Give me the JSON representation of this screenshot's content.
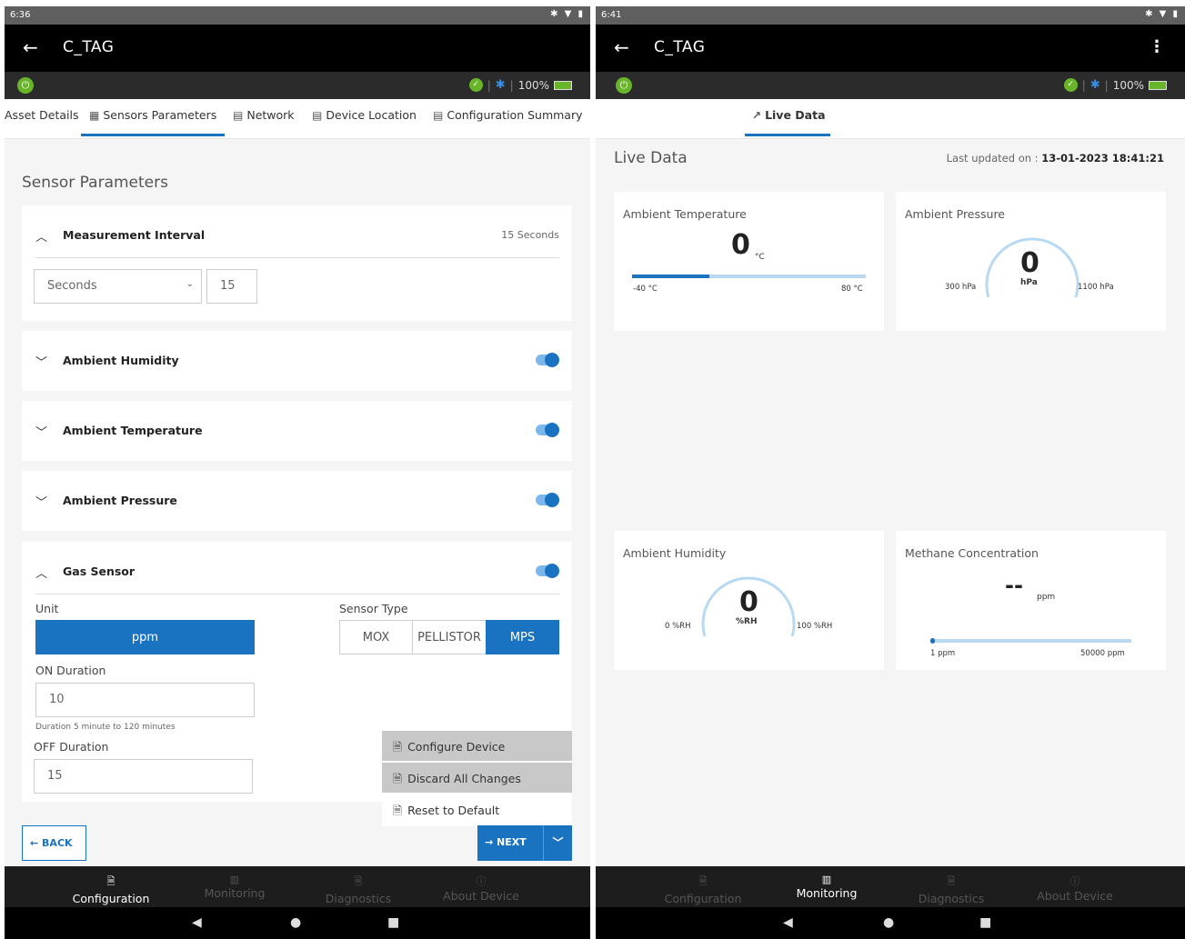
{
  "left": {
    "status_time": "6:36",
    "app_title": "C_TAG",
    "battery": "100%",
    "tabs": [
      "Asset Details",
      "Sensors Parameters",
      "Network",
      "Device Location",
      "Configuration Summary"
    ],
    "active_tab": "Sensors Parameters",
    "page_title": "Sensor Parameters",
    "measurement": {
      "label": "Measurement Interval",
      "value": "15 Seconds",
      "unit_select": "Seconds",
      "interval": "15"
    },
    "sections": [
      "Ambient Humidity",
      "Ambient Temperature",
      "Ambient Pressure"
    ],
    "toggles_on": true,
    "gas": {
      "label": "Gas Sensor",
      "unit_label": "Unit",
      "unit_value": "ppm",
      "sensor_type_label": "Sensor Type",
      "sensor_types": [
        "MOX",
        "PELLISTOR",
        "MPS"
      ],
      "selected_type": "MPS",
      "on_label": "ON Duration",
      "on_value": "10",
      "on_hint": "Duration 5 minute to 120 minutes",
      "off_label": "OFF Duration",
      "off_value": "15"
    },
    "menu": [
      "Configure Device",
      "Discard All Changes",
      "Reset to Default"
    ],
    "back_label": "BACK",
    "next_label": "NEXT",
    "bottom_nav": [
      "Configuration",
      "Monitoring",
      "Diagnostics",
      "About Device"
    ],
    "active_nav": "Configuration"
  },
  "right": {
    "status_time": "6:41",
    "app_title": "C_TAG",
    "battery": "100%",
    "tab": "Live Data",
    "page_title": "Live Data",
    "updated_label": "Last updated on : ",
    "updated_value": "13-01-2023 18:41:21",
    "temperature": {
      "title": "Ambient Temperature",
      "value": "0",
      "unit": "°C",
      "min": "-40 °C",
      "max": "80 °C",
      "fill_fraction": 0.33
    },
    "pressure": {
      "title": "Ambient Pressure",
      "value": "0",
      "unit": "hPa",
      "min": "300 hPa",
      "max": "1100 hPa"
    },
    "humidity": {
      "title": "Ambient Humidity",
      "value": "0",
      "unit": "%RH",
      "min": "0 %RH",
      "max": "100 %RH"
    },
    "methane": {
      "title": "Methane Concentration",
      "value": "--",
      "unit": "ppm",
      "min": "1 ppm",
      "max": "50000 ppm"
    },
    "bottom_nav": [
      "Configuration",
      "Monitoring",
      "Diagnostics",
      "About Device"
    ],
    "active_nav": "Monitoring"
  },
  "accent_color": "#1a73c0",
  "ok_color": "#69b52a"
}
